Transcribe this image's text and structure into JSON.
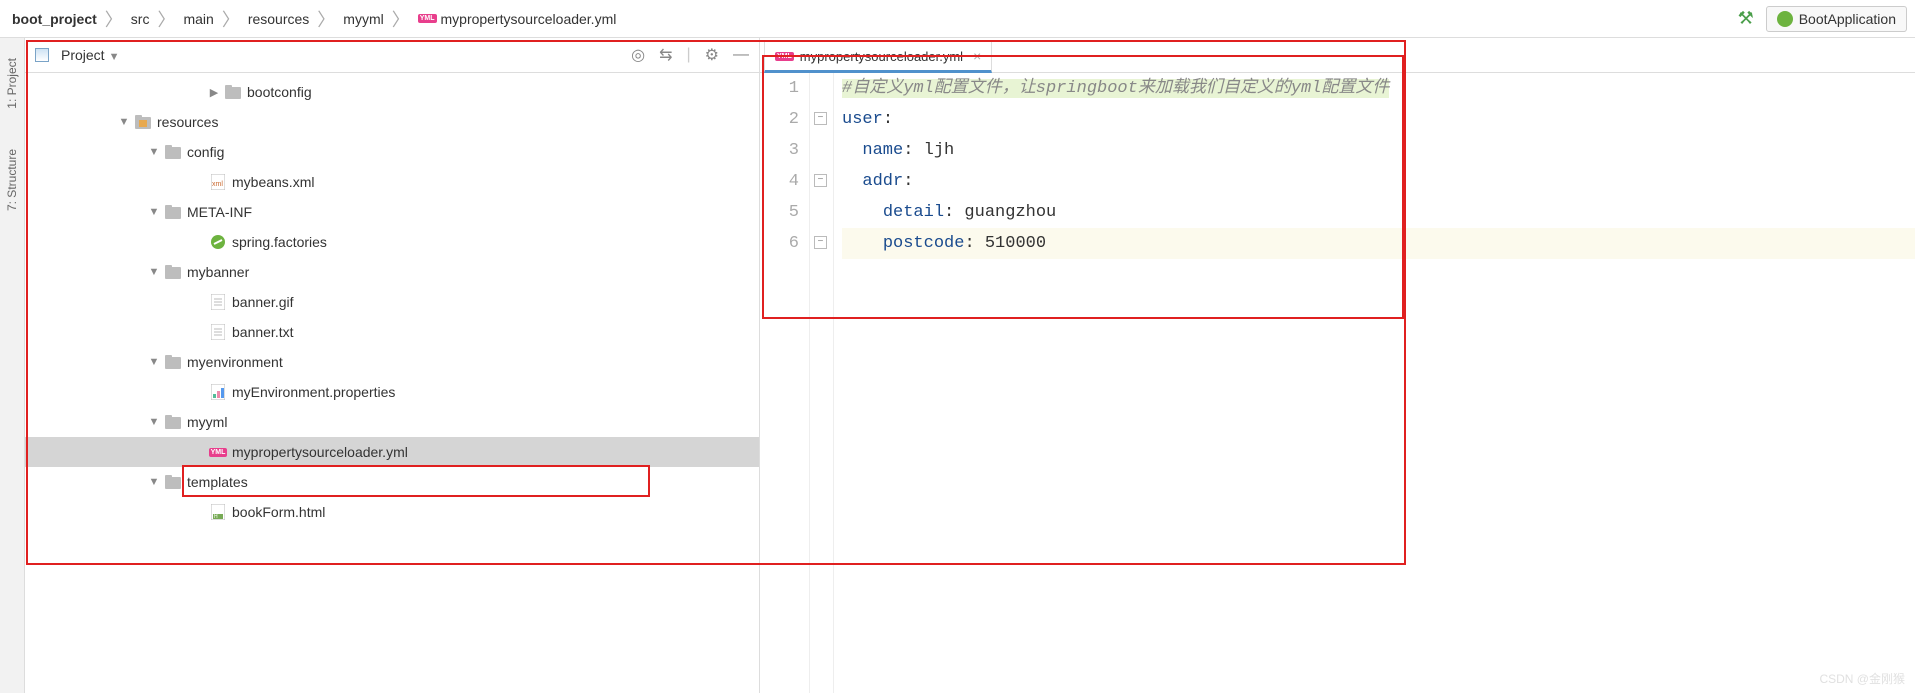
{
  "breadcrumb": [
    {
      "label": "boot_project",
      "bold": true
    },
    {
      "label": "src"
    },
    {
      "label": "main"
    },
    {
      "label": "resources"
    },
    {
      "label": "myyml"
    },
    {
      "label": "mypropertysourceloader.yml",
      "icon": "yml"
    }
  ],
  "runConfig": "BootApplication",
  "sideTabs": {
    "project": "1: Project",
    "structure": "7: Structure"
  },
  "projectPanel": {
    "title": "Project"
  },
  "tree": [
    {
      "indent": 180,
      "arrow": "right",
      "icon": "folder",
      "label": "bootconfig"
    },
    {
      "indent": 90,
      "arrow": "down",
      "icon": "res-folder",
      "label": "resources"
    },
    {
      "indent": 120,
      "arrow": "down",
      "icon": "folder",
      "label": "config"
    },
    {
      "indent": 165,
      "arrow": "",
      "icon": "xml",
      "label": "mybeans.xml"
    },
    {
      "indent": 120,
      "arrow": "down",
      "icon": "folder",
      "label": "META-INF"
    },
    {
      "indent": 165,
      "arrow": "",
      "icon": "spring",
      "label": "spring.factories"
    },
    {
      "indent": 120,
      "arrow": "down",
      "icon": "folder",
      "label": "mybanner"
    },
    {
      "indent": 165,
      "arrow": "",
      "icon": "file",
      "label": "banner.gif"
    },
    {
      "indent": 165,
      "arrow": "",
      "icon": "file",
      "label": "banner.txt"
    },
    {
      "indent": 120,
      "arrow": "down",
      "icon": "folder",
      "label": "myenvironment"
    },
    {
      "indent": 165,
      "arrow": "",
      "icon": "props",
      "label": "myEnvironment.properties"
    },
    {
      "indent": 120,
      "arrow": "down",
      "icon": "folder",
      "label": "myyml"
    },
    {
      "indent": 165,
      "arrow": "",
      "icon": "yml",
      "label": "mypropertysourceloader.yml",
      "selected": true
    },
    {
      "indent": 120,
      "arrow": "down",
      "icon": "folder",
      "label": "templates"
    },
    {
      "indent": 165,
      "arrow": "",
      "icon": "html",
      "label": "bookForm.html"
    }
  ],
  "editor": {
    "tabName": "mypropertysourceloader.yml",
    "lines": [
      {
        "num": 1,
        "type": "comment",
        "text": "#自定义yml配置文件，让springboot来加载我们自定义的yml配置文件"
      },
      {
        "num": 2,
        "type": "kv",
        "indent": "",
        "key": "user",
        "value": ""
      },
      {
        "num": 3,
        "type": "kv",
        "indent": "  ",
        "key": "name",
        "value": " ljh"
      },
      {
        "num": 4,
        "type": "kv",
        "indent": "  ",
        "key": "addr",
        "value": ""
      },
      {
        "num": 5,
        "type": "kv",
        "indent": "    ",
        "key": "detail",
        "value": " guangzhou"
      },
      {
        "num": 6,
        "type": "kv",
        "indent": "    ",
        "key": "postcode",
        "value": " 510000",
        "highlight": true
      }
    ]
  },
  "watermark": "CSDN @金刚猴"
}
